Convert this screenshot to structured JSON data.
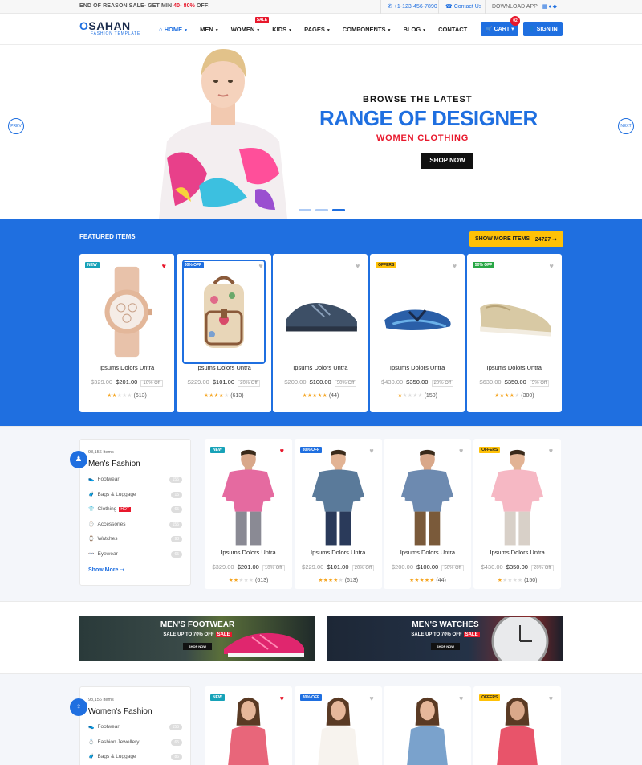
{
  "topbar": {
    "promo_prefix": "END OF REASON SALE- GET MIN ",
    "promo_range": "40- 80%",
    "promo_suffix": " OFF!",
    "phone": "+1-123-456-7890",
    "contact": "Contact Us",
    "download": "DOWNLOAD APP"
  },
  "brand": {
    "name_o": "O",
    "name_rest": "SAHAN",
    "tagline": "FASHION TEMPLATE"
  },
  "nav": {
    "home": "HOME",
    "men": "MEN",
    "women": "WOMEN",
    "sale_tag": "SALE",
    "kids": "KIDS",
    "pages": "PAGES",
    "components": "COMPONENTS",
    "blog": "BLOG",
    "contact": "CONTACT"
  },
  "header": {
    "cart_label": "CART",
    "cart_count": "02",
    "signin": "SIGN IN"
  },
  "hero": {
    "prev": "PREV",
    "next": "NEXT",
    "line1": "BROWSE THE LATEST",
    "line2": "RANGE OF DESIGNER",
    "line3": "WOMEN CLOTHING",
    "cta": "SHOP NOW"
  },
  "featured": {
    "title": "FEATURED ITEMS",
    "show_more": "SHOW MORE ITEMS",
    "count": "24727",
    "products": [
      {
        "badge": "NEW",
        "name": "Ipsums Dolors Untra",
        "old": "$329.00",
        "price": "$201.00",
        "disc": "10% Off",
        "stars": 2,
        "reviews": "(613)",
        "liked": true
      },
      {
        "badge": "30% OFF",
        "name": "Ipsums Dolors Untra",
        "old": "$229.00",
        "price": "$101.00",
        "disc": "20% Off",
        "stars": 4,
        "reviews": "(613)",
        "liked": false
      },
      {
        "badge": "",
        "name": "Ipsums Dolors Untra",
        "old": "$200.00",
        "price": "$100.00",
        "disc": "50% Off",
        "stars": 5,
        "reviews": "(44)",
        "liked": false
      },
      {
        "badge": "OFFERS",
        "name": "Ipsums Dolors Untra",
        "old": "$430.00",
        "price": "$350.00",
        "disc": "20% Off",
        "stars": 1,
        "reviews": "(150)",
        "liked": false
      },
      {
        "badge": "50% OFF",
        "name": "Ipsums Dolors Untra",
        "old": "$630.00",
        "price": "$350.00",
        "disc": "5% Off",
        "stars": 4,
        "reviews": "(300)",
        "liked": false
      }
    ]
  },
  "men": {
    "count": "98,156 Items",
    "title": "Men's Fashion",
    "categories": [
      {
        "label": "Footwear",
        "count": "155"
      },
      {
        "label": "Bags & Luggage",
        "count": "15"
      },
      {
        "label": "Clothing",
        "count": "65",
        "hot": "HOT"
      },
      {
        "label": "Accessories",
        "count": "155"
      },
      {
        "label": "Watches",
        "count": "98"
      },
      {
        "label": "Eyewear",
        "count": "65"
      }
    ],
    "show_more": "Show More",
    "products": [
      {
        "badge": "NEW",
        "name": "Ipsums Dolors Untra",
        "old": "$329.00",
        "price": "$201.00",
        "disc": "10% Off",
        "stars": 2,
        "reviews": "(613)",
        "liked": true
      },
      {
        "badge": "30% OFF",
        "name": "Ipsums Dolors Untra",
        "old": "$229.00",
        "price": "$101.00",
        "disc": "20% Off",
        "stars": 4,
        "reviews": "(613)",
        "liked": false
      },
      {
        "badge": "",
        "name": "Ipsums Dolors Untra",
        "old": "$200.00",
        "price": "$100.00",
        "disc": "50% Off",
        "stars": 5,
        "reviews": "(44)",
        "liked": false
      },
      {
        "badge": "OFFERS",
        "name": "Ipsums Dolors Untra",
        "old": "$430.00",
        "price": "$350.00",
        "disc": "20% Off",
        "stars": 1,
        "reviews": "(150)",
        "liked": false
      }
    ]
  },
  "promos": [
    {
      "title": "MEN'S FOOTWEAR",
      "sub": "SALE UP TO 70% OFF",
      "tag": "SALE",
      "cta": "SHOP NOW"
    },
    {
      "title": "MEN'S WATCHES",
      "sub": "SALE UP TO 70% OFF",
      "tag": "SALE",
      "cta": "SHOP NOW"
    }
  ],
  "women": {
    "count": "98,156 Items",
    "title": "Women's Fashion",
    "categories": [
      {
        "label": "Footwear",
        "count": "155"
      },
      {
        "label": "Fashion Jewellery",
        "count": "65"
      },
      {
        "label": "Bags & Luggage",
        "count": "86"
      }
    ],
    "badges": [
      "NEW",
      "30% OFF",
      "",
      "OFFERS"
    ],
    "liked": [
      true,
      false,
      false,
      false
    ]
  }
}
